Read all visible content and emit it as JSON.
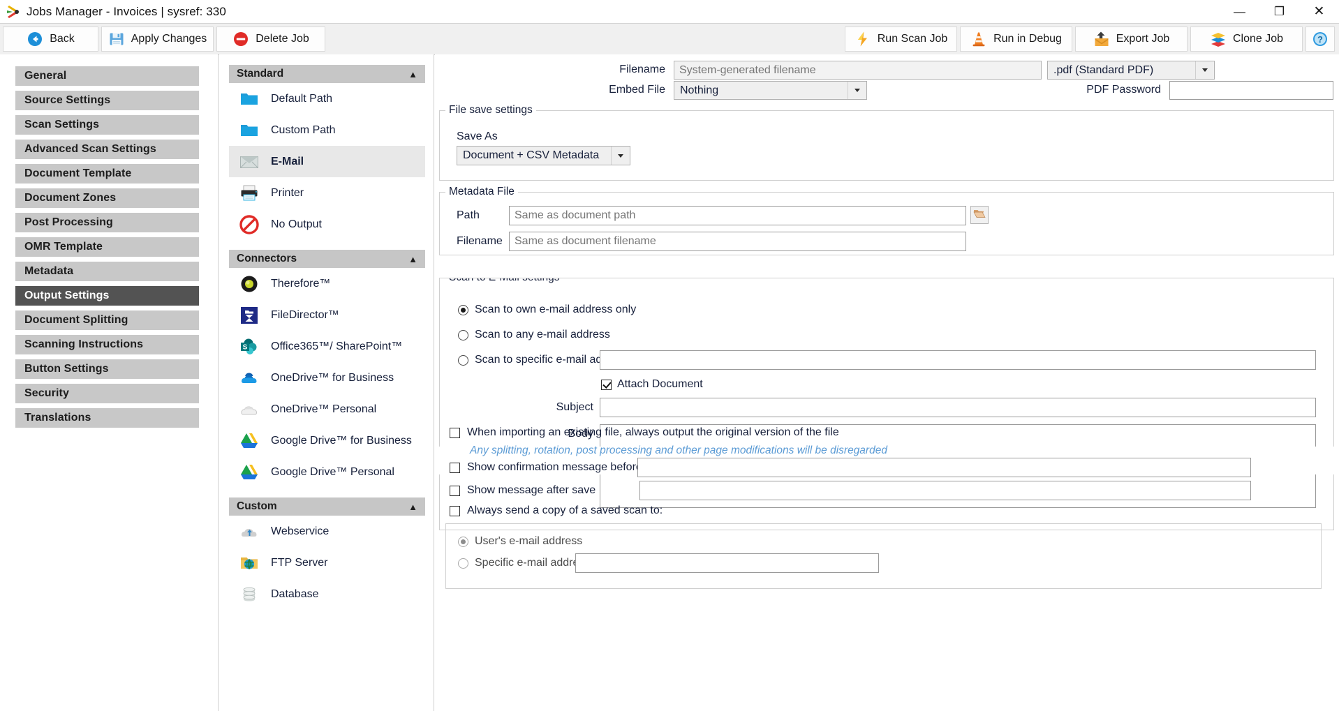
{
  "window": {
    "title": "Jobs Manager - Invoices  |  sysref: 330",
    "app_icon": "scissors-icon",
    "controls": [
      {
        "name": "minimize-button",
        "glyph": "—"
      },
      {
        "name": "restore-button",
        "glyph": "❐"
      },
      {
        "name": "close-button",
        "glyph": "✕"
      }
    ]
  },
  "toolbar": {
    "left": [
      {
        "label": "Back",
        "icon": "back-arrow-icon",
        "name": "back-button",
        "w": "w-back"
      },
      {
        "label": "Apply Changes",
        "icon": "save-floppy-icon",
        "name": "apply-changes-button",
        "w": "w-apply"
      },
      {
        "label": "Delete Job",
        "icon": "delete-circle-icon",
        "name": "delete-job-button",
        "w": "w-delete"
      }
    ],
    "right": [
      {
        "label": "Run Scan Job",
        "icon": "lightning-bolt-icon",
        "name": "run-scan-job-button",
        "w": "w-run"
      },
      {
        "label": "Run in Debug",
        "icon": "traffic-cone-icon",
        "name": "run-in-debug-button",
        "w": "w-debug"
      },
      {
        "label": "Export Job",
        "icon": "export-upload-icon",
        "name": "export-job-button",
        "w": "w-export"
      },
      {
        "label": "Clone Job",
        "icon": "layers-stack-icon",
        "name": "clone-job-button",
        "w": "w-clone"
      },
      {
        "label": "",
        "icon": "help-question-icon",
        "name": "help-button",
        "w": "w-help"
      }
    ]
  },
  "sidebar": {
    "items": [
      {
        "label": "General",
        "active": false
      },
      {
        "label": "Source Settings",
        "active": false
      },
      {
        "label": "Scan Settings",
        "active": false
      },
      {
        "label": "Advanced Scan Settings",
        "active": false
      },
      {
        "label": "Document Template",
        "active": false
      },
      {
        "label": "Document Zones",
        "active": false
      },
      {
        "label": "Post Processing",
        "active": false
      },
      {
        "label": "OMR Template",
        "active": false
      },
      {
        "label": "Metadata",
        "active": false
      },
      {
        "label": "Output Settings",
        "active": true
      },
      {
        "label": "Document Splitting",
        "active": false
      },
      {
        "label": "Scanning Instructions",
        "active": false
      },
      {
        "label": "Button Settings",
        "active": false
      },
      {
        "label": "Security",
        "active": false
      },
      {
        "label": "Translations",
        "active": false
      }
    ]
  },
  "output_panel": {
    "groups": [
      {
        "title": "Standard",
        "collapse_icon": "chevron-up-double-icon",
        "items": [
          {
            "label": "Default Path",
            "icon": "folder-blue-icon",
            "selected": false
          },
          {
            "label": "Custom Path",
            "icon": "folder-blue-icon",
            "selected": false
          },
          {
            "label": "E-Mail",
            "icon": "envelope-icon",
            "selected": true
          },
          {
            "label": "Printer",
            "icon": "printer-icon",
            "selected": false
          },
          {
            "label": "No Output",
            "icon": "no-entry-icon",
            "selected": false
          }
        ]
      },
      {
        "title": "Connectors",
        "collapse_icon": "chevron-up-double-icon",
        "items": [
          {
            "label": "Therefore™",
            "icon": "therefore-logo-icon",
            "selected": false
          },
          {
            "label": "FileDirector™",
            "icon": "filedirector-logo-icon",
            "selected": false
          },
          {
            "label": "Office365™/ SharePoint™",
            "icon": "sharepoint-logo-icon",
            "selected": false
          },
          {
            "label": "OneDrive™ for Business",
            "icon": "onedrive-business-icon",
            "selected": false
          },
          {
            "label": "OneDrive™ Personal",
            "icon": "onedrive-personal-icon",
            "selected": false
          },
          {
            "label": "Google Drive™ for Business",
            "icon": "google-drive-icon",
            "selected": false
          },
          {
            "label": "Google Drive™ Personal",
            "icon": "google-drive-icon",
            "selected": false
          }
        ]
      },
      {
        "title": "Custom",
        "collapse_icon": "chevron-up-double-icon",
        "items": [
          {
            "label": "Webservice",
            "icon": "cloud-upload-icon",
            "selected": false
          },
          {
            "label": "FTP Server",
            "icon": "ftp-globe-folder-icon",
            "selected": false
          },
          {
            "label": "Database",
            "icon": "database-cylinder-icon",
            "selected": false
          }
        ]
      }
    ]
  },
  "main": {
    "filename": {
      "label": "Filename",
      "value": "",
      "placeholder": "System-generated filename"
    },
    "format": {
      "value": ".pdf (Standard PDF)"
    },
    "embed_file": {
      "label": "Embed File",
      "value": "Nothing"
    },
    "pdf_password": {
      "label": "PDF Password",
      "value": ""
    },
    "file_save_settings": {
      "legend": "File save settings",
      "save_as_label": "Save As",
      "save_as_value": "Document + CSV Metadata"
    },
    "metadata_file": {
      "legend": "Metadata File",
      "path_label": "Path",
      "path_value": "",
      "path_placeholder": "Same as document path",
      "browse_icon": "folder-open-icon",
      "filename_label": "Filename",
      "filename_value": "",
      "filename_placeholder": "Same as document filename"
    },
    "scan_to_email": {
      "legend": "Scan to E-Mail settings",
      "options": [
        {
          "label": "Scan to own e-mail address only",
          "selected": true
        },
        {
          "label": "Scan to any e-mail address",
          "selected": false
        },
        {
          "label": "Scan to specific e-mail address",
          "selected": false
        }
      ],
      "specific_address_value": "",
      "attach_document_label": "Attach Document",
      "attach_document_checked": true,
      "subject_label": "Subject",
      "subject_value": "",
      "body_label": "Body"
    },
    "options": {
      "original_version_label": "When importing an existing file, always output the original version of the file",
      "original_version_checked": false,
      "original_version_hint": "Any splitting, rotation, post processing and other page modifications will be disregarded",
      "confirm_before_save_label": "Show confirmation message before save",
      "confirm_before_save_checked": false,
      "confirm_before_save_value": "",
      "message_after_save_label": "Show message after save",
      "message_after_save_checked": false,
      "message_after_save_value": "",
      "always_send_copy_label": "Always send a copy of a saved scan to:",
      "always_send_copy_checked": false,
      "copy_options": [
        {
          "label": "User's e-mail address",
          "selected": true
        },
        {
          "label": "Specific e-mail address",
          "selected": false
        }
      ],
      "specific_copy_value": ""
    }
  },
  "colors": {
    "accent_blue": "#0078d4",
    "nav_active": "#535353",
    "nav_item": "#c8c8c8",
    "hint_blue": "#5b9bd5"
  }
}
